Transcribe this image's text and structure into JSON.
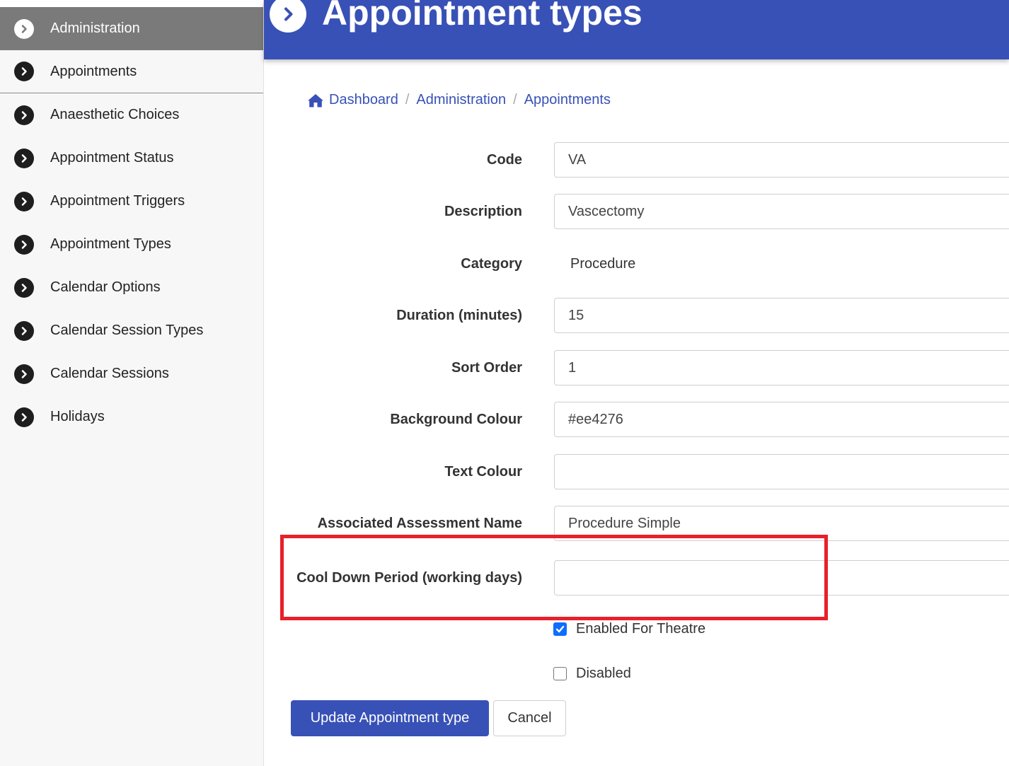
{
  "sidebar": {
    "items": [
      {
        "label": "Administration",
        "icon": "chevron-circle-right-icon",
        "active": true
      },
      {
        "label": "Appointments",
        "icon": "chevron-circle-right-icon"
      },
      {
        "label": "Anaesthetic Choices",
        "icon": "chevron-circle-right-icon"
      },
      {
        "label": "Appointment Status",
        "icon": "chevron-circle-right-icon"
      },
      {
        "label": "Appointment Triggers",
        "icon": "chevron-circle-right-icon"
      },
      {
        "label": "Appointment Types",
        "icon": "chevron-circle-right-icon"
      },
      {
        "label": "Calendar Options",
        "icon": "chevron-circle-right-icon"
      },
      {
        "label": "Calendar Session Types",
        "icon": "chevron-circle-right-icon"
      },
      {
        "label": "Calendar Sessions",
        "icon": "chevron-circle-right-icon"
      },
      {
        "label": "Holidays",
        "icon": "chevron-circle-right-icon"
      }
    ]
  },
  "header": {
    "title": "Appointment types",
    "icon": "chevron-circle-right-icon",
    "color": "#3851b6"
  },
  "breadcrumb": {
    "items": [
      {
        "label": "Dashboard",
        "icon": "home-icon"
      },
      {
        "label": "Administration"
      },
      {
        "label": "Appointments"
      }
    ],
    "separator": "/"
  },
  "form": {
    "code": {
      "label": "Code",
      "value": "VA"
    },
    "description": {
      "label": "Description",
      "value": "Vascectomy"
    },
    "category": {
      "label": "Category",
      "value": "Procedure"
    },
    "duration": {
      "label": "Duration (minutes)",
      "value": "15"
    },
    "sort_order": {
      "label": "Sort Order",
      "value": "1"
    },
    "background_colour": {
      "label": "Background Colour",
      "value": "#ee4276"
    },
    "text_colour": {
      "label": "Text Colour",
      "value": ""
    },
    "associated_assessment": {
      "label": "Associated Assessment Name",
      "value": "Procedure Simple"
    },
    "cool_down": {
      "label": "Cool Down Period (working days)",
      "value": ""
    },
    "enabled_for_theatre": {
      "label": "Enabled For Theatre",
      "checked": true
    },
    "disabled": {
      "label": "Disabled",
      "checked": false
    }
  },
  "actions": {
    "update_label": "Update Appointment type",
    "cancel_label": "Cancel"
  },
  "colors": {
    "accent": "#3851b6",
    "sidebar_active": "#7a7a7a",
    "highlight": "#e8202a",
    "checkbox": "#0d6efd"
  }
}
